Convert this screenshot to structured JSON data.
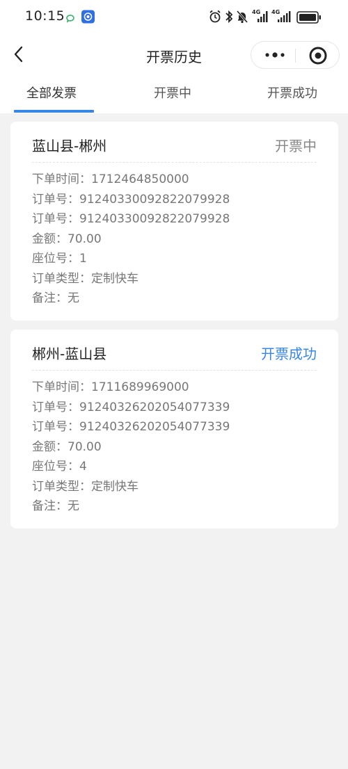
{
  "status_bar": {
    "time": "10:15",
    "signal_1_label": "4G",
    "signal_2_label": "4G"
  },
  "nav": {
    "title": "开票历史"
  },
  "tabs": [
    {
      "label": "全部发票",
      "active": true
    },
    {
      "label": "开票中",
      "active": false
    },
    {
      "label": "开票成功",
      "active": false
    }
  ],
  "colors": {
    "accent": "#3a86e6",
    "status_pending": "#888888",
    "status_success": "#3a86e6",
    "background": "#f2f2f2"
  },
  "invoices": [
    {
      "route": "蓝山县-郴州",
      "status": "开票中",
      "order_time_label": "下单时间：",
      "order_time": "1712464850000",
      "order_no_label": "订单号：",
      "order_no": "91240330092822079928",
      "order_no_2_label": "订单号：",
      "order_no_2": "91240330092822079928",
      "amount_label": "金额：",
      "amount": "70.00",
      "seat_label": "座位号：",
      "seat": "1",
      "order_type_label": "订单类型：",
      "order_type": "定制快车",
      "remark_label": "备注：",
      "remark": "无"
    },
    {
      "route": "郴州-蓝山县",
      "status": "开票成功",
      "order_time_label": "下单时间：",
      "order_time": "1711689969000",
      "order_no_label": "订单号：",
      "order_no": "91240326202054077339",
      "order_no_2_label": "订单号：",
      "order_no_2": "91240326202054077339",
      "amount_label": "金额：",
      "amount": "70.00",
      "seat_label": "座位号：",
      "seat": "4",
      "order_type_label": "订单类型：",
      "order_type": "定制快车",
      "remark_label": "备注：",
      "remark": "无"
    }
  ]
}
